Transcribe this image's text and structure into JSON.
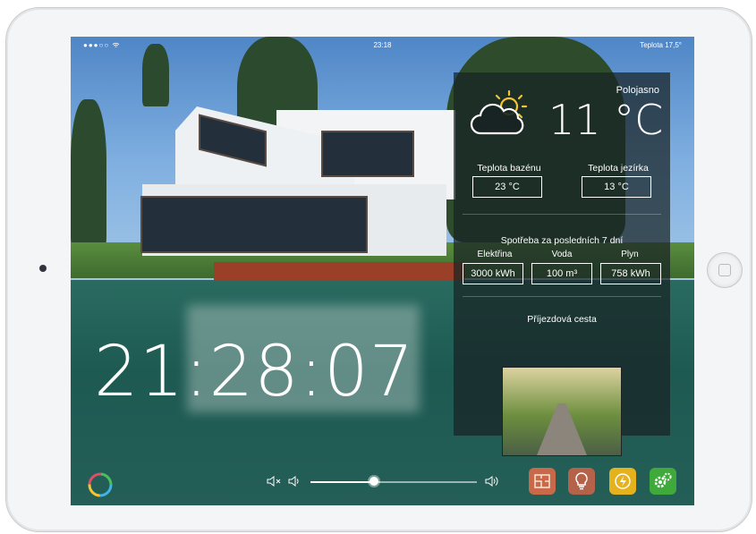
{
  "status_bar": {
    "signal": "●●●○○",
    "wifi_icon": "wifi-icon",
    "time": "23:18",
    "temperature": "Teplota 17,5°"
  },
  "clock": "21:28:07",
  "weather": {
    "condition": "Polojasno",
    "icon": "partly-cloudy-icon",
    "temperature": "11 °C"
  },
  "pools": {
    "pool_label": "Teplota bazénu",
    "pool_value": "23 °C",
    "pond_label": "Teplota jezírka",
    "pond_value": "13 °C"
  },
  "consumption": {
    "title": "Spotřeba za posledních 7 dní",
    "items": [
      {
        "label": "Elektřina",
        "value": "3000 kWh"
      },
      {
        "label": "Voda",
        "value": "100 m³"
      },
      {
        "label": "Plyn",
        "value": "758 kWh"
      }
    ]
  },
  "driveway": {
    "title": "Příjezdová cesta"
  },
  "volume": {
    "mute_icon": "mute-icon",
    "down_icon": "volume-down-icon",
    "up_icon": "volume-up-icon",
    "level": 0.38
  },
  "apps": [
    {
      "name": "floorplan-icon",
      "color": "#c86a4a"
    },
    {
      "name": "lightbulb-icon",
      "color": "#b5624a"
    },
    {
      "name": "energy-icon",
      "color": "#e5b11d"
    },
    {
      "name": "settings-icon",
      "color": "#3faa3b"
    }
  ]
}
